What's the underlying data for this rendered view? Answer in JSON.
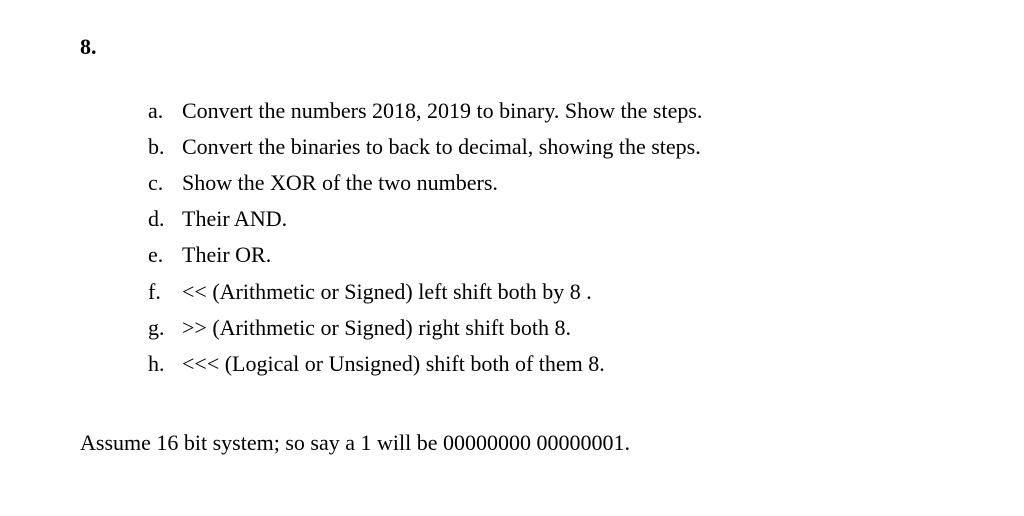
{
  "question": {
    "number": "8.",
    "items": [
      {
        "label": "a.",
        "text": "Convert the numbers 2018, 2019 to binary. Show the steps."
      },
      {
        "label": "b.",
        "text": "Convert the binaries to back to decimal, showing the steps."
      },
      {
        "label": "c.",
        "text": "Show the XOR of the two numbers."
      },
      {
        "label": "d.",
        "text": "Their AND."
      },
      {
        "label": "e.",
        "text": "Their OR."
      },
      {
        "label": "f.",
        "text": "<< (Arithmetic or Signed) left shift both by 8 ."
      },
      {
        "label": "g.",
        "text": ">> (Arithmetic or Signed) right shift both 8."
      },
      {
        "label": "h.",
        "text": "<<< (Logical or Unsigned) shift both of them 8."
      }
    ],
    "note": "Assume 16 bit system; so say a 1 will be 00000000 00000001."
  }
}
